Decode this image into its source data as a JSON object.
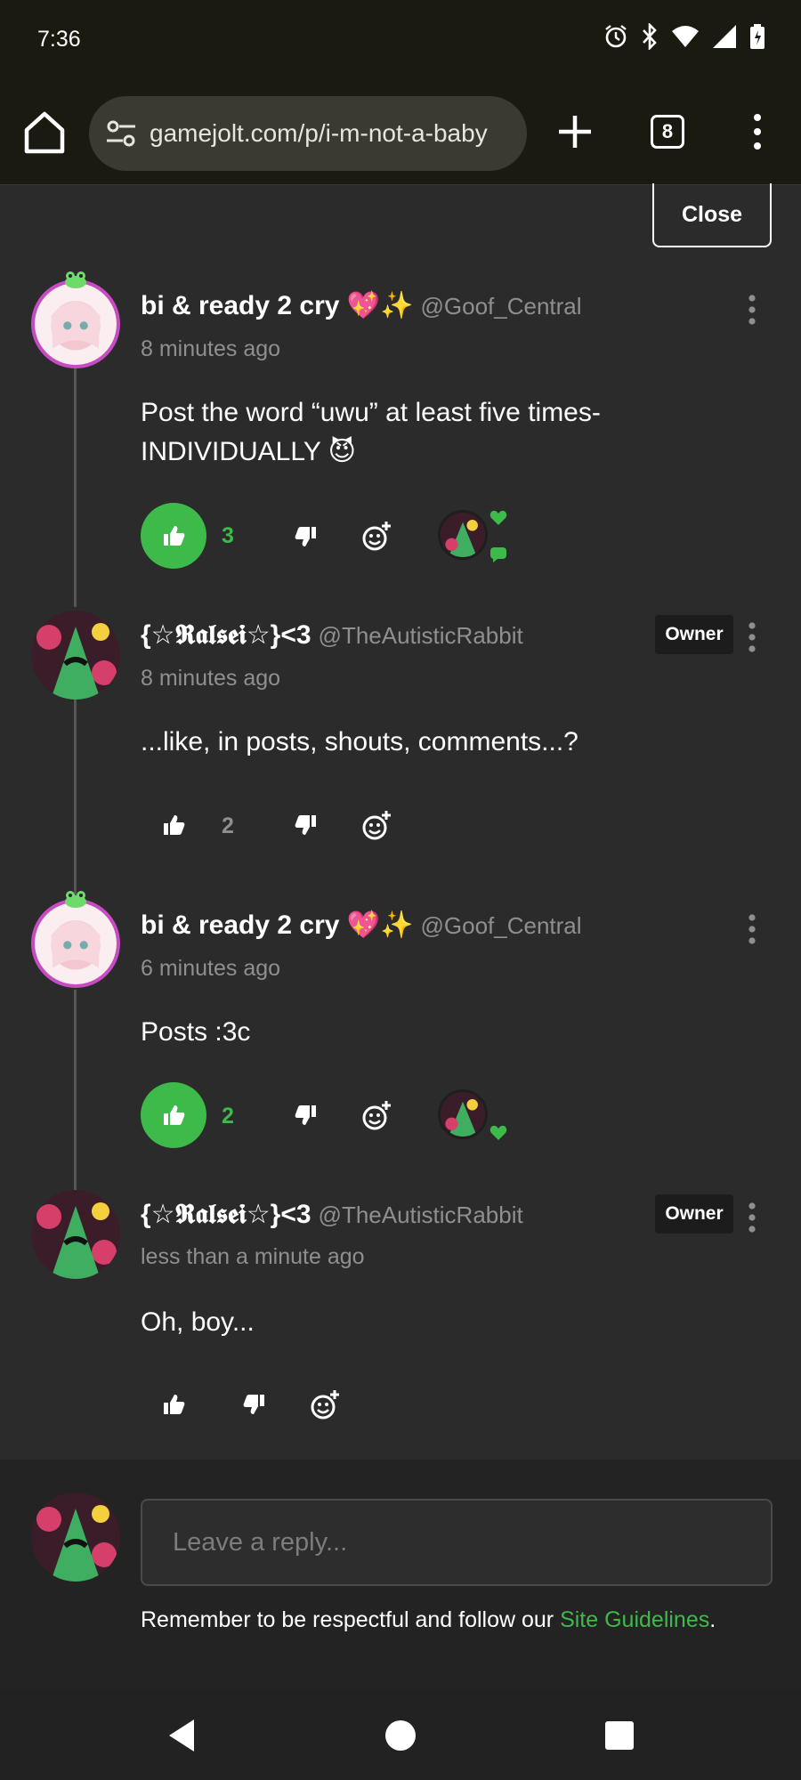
{
  "status_bar": {
    "time": "7:36"
  },
  "browser": {
    "url": "gamejolt.com/p/i-m-not-a-baby",
    "tab_count": "8"
  },
  "close_label": "Close",
  "comments": [
    {
      "author": "bi & ready 2 cry 💖✨",
      "handle": "@Goof_Central",
      "time": "8 minutes ago",
      "body_line1": "Post the word “uwu” at least five times-",
      "body_line2": "INDIVIDUALLY 😈",
      "likes": "3",
      "liked": true
    },
    {
      "author": "{☆𝕽𝖆𝖑𝖘𝖊𝖎☆}<3",
      "handle": "@TheAutisticRabbit",
      "badge": "Owner",
      "time": "8 minutes ago",
      "body": "...like, in posts, shouts, comments...?",
      "likes": "2",
      "liked": false
    },
    {
      "author": "bi & ready 2 cry 💖✨",
      "handle": "@Goof_Central",
      "time": "6 minutes ago",
      "body": "Posts :3c",
      "likes": "2",
      "liked": true
    },
    {
      "author": "{☆𝕽𝖆𝖑𝖘𝖊𝖎☆}<3",
      "handle": "@TheAutisticRabbit",
      "badge": "Owner",
      "time": "less than a minute ago",
      "body": "Oh, boy...",
      "likes": "",
      "liked": false
    }
  ],
  "reply": {
    "placeholder": "Leave a reply...",
    "note_prefix": "Remember to be respectful and follow our ",
    "note_link": "Site Guidelines",
    "note_suffix": "."
  },
  "colors": {
    "accent": "#3dba4a",
    "background": "#2b2b2c",
    "muted_text": "#8f8f90"
  },
  "icons": [
    "home-icon",
    "site-settings-icon",
    "plus-icon",
    "more-vert-icon",
    "thumbs-up-icon",
    "thumbs-down-icon",
    "add-reaction-icon",
    "heart-icon",
    "back-nav-icon",
    "home-nav-icon",
    "recents-nav-icon"
  ]
}
